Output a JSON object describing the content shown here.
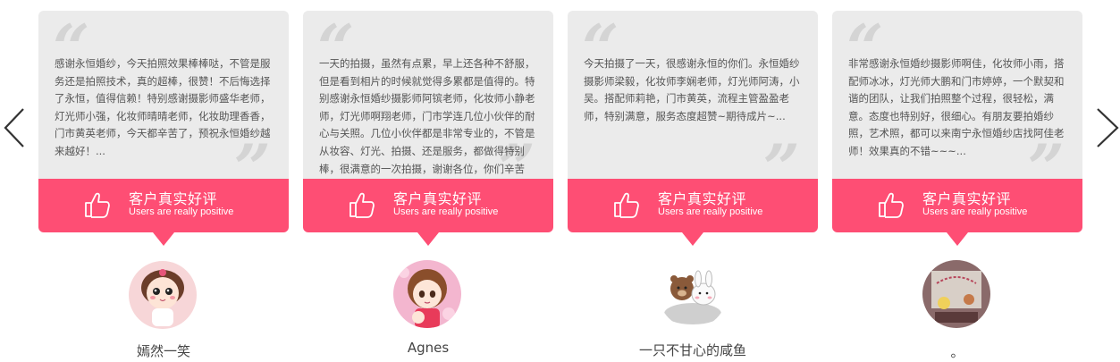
{
  "reviews": [
    {
      "text": "感谢永恒婚纱，今天拍照效果棒棒哒，不管是服务还是拍照技术，真的超棒，很赞！不后悔选择了永恒，值得信赖！特别感谢摄影师盛华老师，灯光师小强，化妆师晴晴老师，化妆助理香香，门市黄英老师，今天都辛苦了，预祝永恒婚纱越来越好！...",
      "badge_title": "客户真实好评",
      "badge_sub": "Users are really positive",
      "username": "嫣然一笑"
    },
    {
      "text": "一天的拍摄，虽然有点累，早上还各种不舒服，但是看到相片的时候就觉得多累都是值得的。特别感谢永恒婚纱摄影师阿镔老师，化妆师小静老师，灯光师啊翔老师，门市学连几位小伙伴的耐心与关照。几位小伙伴都是非常专业的，不管是从妆容、灯光、拍摄、还是服务，都做得特别棒，很满意的一次拍摄，谢谢各位，你们辛苦了！~~~...",
      "badge_title": "客户真实好评",
      "badge_sub": "Users are really positive",
      "username": "Agnes"
    },
    {
      "text": "今天拍摄了一天，很感谢永恒的你们。永恒婚纱摄影师梁毅，化妆师李娴老师，灯光师阿涛，小吴。搭配师莉艳，门市黄英，流程主管盈盈老师，特别满意，服务态度超赞~期待成片~...",
      "badge_title": "客户真实好评",
      "badge_sub": "Users are really positive",
      "username": "一只不甘心的咸鱼"
    },
    {
      "text": "非常感谢永恒婚纱摄影师啊佳，化妆师小雨，搭配师冰冰，灯光师大鹏和门市婷婷，一个默契和谐的团队，让我们拍照整个过程，很轻松，满意。态度也特别好，很细心。有朋友要拍婚纱照，艺术照，都可以来南宁永恒婚纱店找阿佳老师！效果真的不错~~~...",
      "badge_title": "客户真实好评",
      "badge_sub": "Users are really positive",
      "username": "。"
    }
  ],
  "icons": {
    "prev": "chevron-left-icon",
    "next": "chevron-right-icon",
    "badge": "thumbs-up-icon",
    "quote": "quote-mark-icon"
  },
  "colors": {
    "accent": "#fe4e74",
    "card_bg": "#ebebeb",
    "quote_mark": "#d4d4d4",
    "text": "#555555"
  }
}
